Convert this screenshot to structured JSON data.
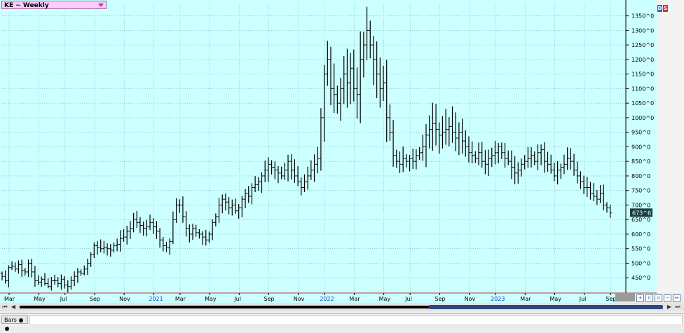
{
  "window": {
    "title": "KE ~ Weekly"
  },
  "toolbar": {
    "bars_label": "Bars"
  },
  "colors": {
    "background": "#ccffff",
    "bars": "#000000",
    "last_price_bg": "#1a3f3f",
    "title_bg": "#ffccff",
    "scroll_thumb": "#2a4a86",
    "year_label": "#1a3fd6"
  },
  "icons": {
    "dropdown": "chevron-down-icon",
    "scroll_left": "arrow-left-icon",
    "scroll_right": "arrow-right-icon"
  },
  "chart_data": {
    "type": "bar",
    "title": "KE ~ Weekly",
    "bar_style": "OHLC",
    "ylim": [
      412,
      1390
    ],
    "y_ticks": [
      "1350^0",
      "1300^0",
      "1250^0",
      "1200^0",
      "1150^0",
      "1100^0",
      "1050^0",
      "1000^0",
      "950^0",
      "900^0",
      "850^0",
      "800^0",
      "750^0",
      "700^0",
      "650^0",
      "600^0",
      "550^0",
      "500^0",
      "450^0"
    ],
    "y_tick_values": [
      1350,
      1300,
      1250,
      1200,
      1150,
      1100,
      1050,
      1000,
      950,
      900,
      850,
      800,
      750,
      700,
      650,
      600,
      550,
      500,
      450
    ],
    "last_price": {
      "label": "673^6",
      "value": 673.75
    },
    "x_ticks": [
      {
        "label": "Mar",
        "week": 0,
        "year": false
      },
      {
        "label": "May",
        "week": 9,
        "year": false
      },
      {
        "label": "Jul",
        "week": 17,
        "year": false
      },
      {
        "label": "Sep",
        "week": 26,
        "year": false
      },
      {
        "label": "Nov",
        "week": 35,
        "year": false
      },
      {
        "label": "2021",
        "week": 44,
        "year": true
      },
      {
        "label": "Mar",
        "week": 52,
        "year": false
      },
      {
        "label": "May",
        "week": 61,
        "year": false
      },
      {
        "label": "Jul",
        "week": 70,
        "year": false
      },
      {
        "label": "Sep",
        "week": 79,
        "year": false
      },
      {
        "label": "Nov",
        "week": 88,
        "year": false
      },
      {
        "label": "2022",
        "week": 96,
        "year": true
      },
      {
        "label": "Mar",
        "week": 105,
        "year": false
      },
      {
        "label": "May",
        "week": 114,
        "year": false
      },
      {
        "label": "Jul",
        "week": 122,
        "year": false
      },
      {
        "label": "Sep",
        "week": 131,
        "year": false
      },
      {
        "label": "Nov",
        "week": 140,
        "year": false
      },
      {
        "label": "2023",
        "week": 148,
        "year": true
      },
      {
        "label": "Mar",
        "week": 157,
        "year": false
      },
      {
        "label": "May",
        "week": 166,
        "year": false
      },
      {
        "label": "Jul",
        "week": 175,
        "year": false
      },
      {
        "label": "Sep",
        "week": 183,
        "year": false
      }
    ],
    "weeks_total": 188,
    "closes": [
      455,
      440,
      485,
      490,
      480,
      495,
      475,
      470,
      500,
      470,
      440,
      435,
      445,
      430,
      420,
      440,
      440,
      430,
      445,
      425,
      420,
      440,
      455,
      470,
      465,
      480,
      500,
      530,
      560,
      555,
      550,
      555,
      550,
      545,
      560,
      565,
      585,
      590,
      610,
      620,
      650,
      640,
      630,
      620,
      625,
      640,
      625,
      610,
      580,
      560,
      555,
      575,
      650,
      700,
      700,
      660,
      620,
      600,
      620,
      605,
      600,
      590,
      580,
      600,
      640,
      660,
      700,
      720,
      710,
      690,
      700,
      680,
      690,
      720,
      740,
      730,
      760,
      770,
      780,
      800,
      820,
      840,
      830,
      820,
      810,
      800,
      820,
      850,
      820,
      800,
      780,
      760,
      780,
      800,
      820,
      840,
      860,
      1000,
      1150,
      1200,
      1100,
      1080,
      1050,
      1100,
      1150,
      1120,
      1170,
      1100,
      1080,
      1200,
      1250,
      1300,
      1250,
      1200,
      1150,
      1100,
      1120,
      1000,
      950,
      870,
      850,
      840,
      860,
      850,
      860,
      850,
      870,
      880,
      900,
      940,
      960,
      980,
      960,
      940,
      950,
      960,
      970,
      950,
      930,
      950,
      920,
      900,
      880,
      870,
      860,
      880,
      850,
      840,
      860,
      870,
      880,
      900,
      880,
      860,
      850,
      830,
      810,
      820,
      840,
      850,
      860,
      870,
      850,
      880,
      890,
      850,
      840,
      820,
      800,
      820,
      830,
      840,
      860,
      850,
      820,
      800,
      780,
      760,
      760,
      740,
      730,
      720,
      740,
      700,
      690,
      673
    ],
    "ohlc_note": "close values estimated from chart; open/high/low are derived around closes"
  }
}
